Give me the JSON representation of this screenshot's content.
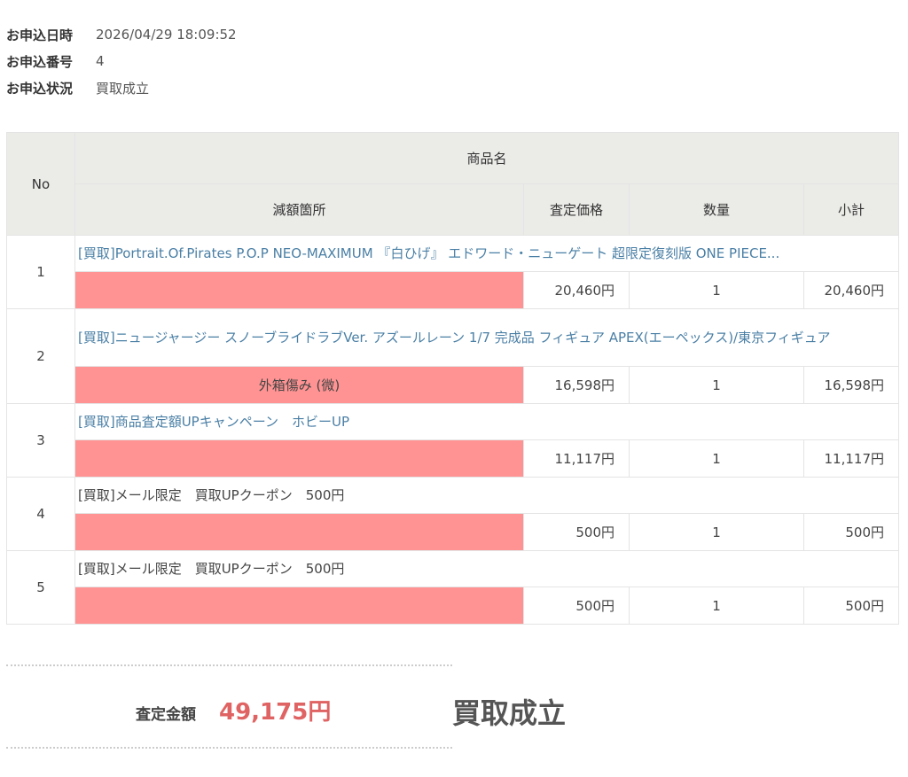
{
  "info": {
    "date_label": "お申込日時",
    "date_value": "2026/04/29 18:09:52",
    "number_label": "お申込番号",
    "number_value": "4",
    "status_label": "お申込状況",
    "status_value": "買取成立"
  },
  "table": {
    "headers": {
      "no": "No",
      "product_name": "商品名",
      "reduction": "減額箇所",
      "price": "査定価格",
      "quantity": "数量",
      "subtotal": "小計"
    },
    "rows": [
      {
        "no": "1",
        "name": "[買取]Portrait.Of.Pirates P.O.P NEO-MAXIMUM 『白ひげ』 エドワード・ニューゲート 超限定復刻版 ONE PIECE...",
        "reduction": "",
        "price": "20,460円",
        "quantity": "1",
        "subtotal": "20,460円"
      },
      {
        "no": "2",
        "name": "[買取]ニュージャージー スノーブライドラブVer. アズールレーン 1/7 完成品 フィギュア APEX(エーペックス)/東京フィギュア",
        "reduction": "外箱傷み (微)",
        "price": "16,598円",
        "quantity": "1",
        "subtotal": "16,598円"
      },
      {
        "no": "3",
        "name": "[買取]商品査定額UPキャンペーン　ホビーUP",
        "reduction": "",
        "price": "11,117円",
        "quantity": "1",
        "subtotal": "11,117円"
      },
      {
        "no": "4",
        "name": "[買取]メール限定　買取UPクーポン　500円",
        "reduction": "",
        "price": "500円",
        "quantity": "1",
        "subtotal": "500円"
      },
      {
        "no": "5",
        "name": "[買取]メール限定　買取UPクーポン　500円",
        "reduction": "",
        "price": "500円",
        "quantity": "1",
        "subtotal": "500円"
      }
    ]
  },
  "summary": {
    "total_label": "査定金額",
    "total_value": "49,175円",
    "status": "買取成立"
  },
  "colors": {
    "reduction_bg": "#ff9393",
    "link": "#4a7fa5",
    "total": "#e06363",
    "header_bg": "#ebebe8"
  }
}
